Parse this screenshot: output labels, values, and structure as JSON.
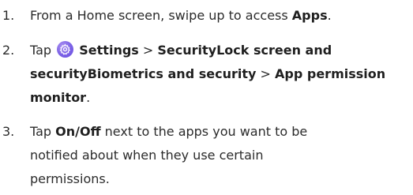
{
  "steps": [
    {
      "number": "1.",
      "prefix": "From a Home screen, swipe up to access ",
      "bold": "Apps",
      "suffix": "."
    },
    {
      "number": "2.",
      "tap": "Tap",
      "icon": "settings-gear-icon",
      "settings": "Settings",
      "sep1": ">",
      "path1": "SecurityLock screen and",
      "path2": "securityBiometrics and security",
      "sep2": ">",
      "path3a": "App permission",
      "path3b": "monitor",
      "end": "."
    },
    {
      "number": "3.",
      "line1_prefix": "Tap ",
      "line1_bold": "On/Off",
      "line1_suffix": " next to the apps you want to be",
      "line2": "notified about when they use certain",
      "line3": "permissions."
    }
  ],
  "colors": {
    "text": "#2b2b2b",
    "icon_bg": "#7b61e6"
  }
}
